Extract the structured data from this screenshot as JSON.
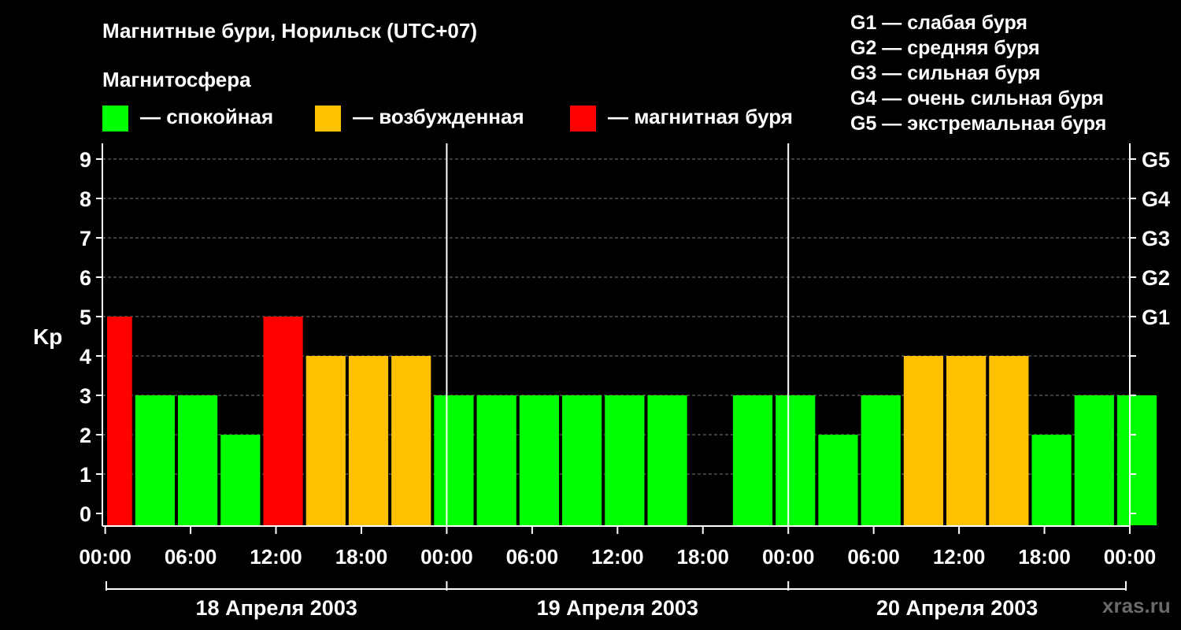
{
  "title": "Магнитные бури, Норильск (UTC+07)",
  "legend": {
    "heading": "Магнитосфера",
    "items": [
      {
        "label": "— спокойная",
        "color": "#00ff00"
      },
      {
        "label": "— возбужденная",
        "color": "#ffc000"
      },
      {
        "label": "— магнитная буря",
        "color": "#ff0000"
      }
    ]
  },
  "g_scale": [
    "G1 — слабая буря",
    "G2 — средняя буря",
    "G3 — сильная буря",
    "G4 — очень сильная буря",
    "G5 — экстремальная буря"
  ],
  "watermark": "xras.ru",
  "chart_data": {
    "type": "bar",
    "ylabel": "Kp",
    "ylim": [
      0,
      9
    ],
    "y_ticks": [
      "0",
      "1",
      "2",
      "3",
      "4",
      "5",
      "6",
      "7",
      "8",
      "9"
    ],
    "right_ticks": [
      {
        "kp": 5,
        "label": "G1"
      },
      {
        "kp": 6,
        "label": "G2"
      },
      {
        "kp": 7,
        "label": "G3"
      },
      {
        "kp": 8,
        "label": "G4"
      },
      {
        "kp": 9,
        "label": "G5"
      }
    ],
    "grid": "horizontal dashed",
    "x_tick_labels": [
      "00:00",
      "06:00",
      "12:00",
      "18:00",
      "00:00",
      "06:00",
      "12:00",
      "18:00",
      "00:00",
      "06:00",
      "12:00",
      "18:00",
      "00:00"
    ],
    "days": [
      "18 Апреля 2003",
      "19 Апреля 2003",
      "20 Апреля 2003"
    ],
    "hours_start": -0.2,
    "hours_end": 72,
    "bars": [
      {
        "start": -1,
        "kp": 5,
        "status": "storm"
      },
      {
        "start": 2,
        "kp": 3,
        "status": "quiet"
      },
      {
        "start": 5,
        "kp": 3,
        "status": "quiet"
      },
      {
        "start": 8,
        "kp": 2,
        "status": "quiet"
      },
      {
        "start": 11,
        "kp": 5,
        "status": "storm"
      },
      {
        "start": 14,
        "kp": 4,
        "status": "active"
      },
      {
        "start": 17,
        "kp": 4,
        "status": "active"
      },
      {
        "start": 20,
        "kp": 4,
        "status": "active"
      },
      {
        "start": 23,
        "kp": 3,
        "status": "quiet"
      },
      {
        "start": 26,
        "kp": 3,
        "status": "quiet"
      },
      {
        "start": 29,
        "kp": 3,
        "status": "quiet"
      },
      {
        "start": 32,
        "kp": 3,
        "status": "quiet"
      },
      {
        "start": 35,
        "kp": 3,
        "status": "quiet"
      },
      {
        "start": 38,
        "kp": 3,
        "status": "quiet"
      },
      {
        "start": 41,
        "kp": 0,
        "status": "quiet"
      },
      {
        "start": 44,
        "kp": 3,
        "status": "quiet"
      },
      {
        "start": 47,
        "kp": 3,
        "status": "quiet"
      },
      {
        "start": 50,
        "kp": 2,
        "status": "quiet"
      },
      {
        "start": 53,
        "kp": 3,
        "status": "quiet"
      },
      {
        "start": 56,
        "kp": 4,
        "status": "active"
      },
      {
        "start": 59,
        "kp": 4,
        "status": "active"
      },
      {
        "start": 62,
        "kp": 4,
        "status": "active"
      },
      {
        "start": 65,
        "kp": 2,
        "status": "quiet"
      },
      {
        "start": 68,
        "kp": 3,
        "status": "quiet"
      },
      {
        "start": 71,
        "kp": 3,
        "status": "quiet"
      }
    ],
    "status_colors": {
      "quiet": "#00ff00",
      "active": "#ffc000",
      "storm": "#ff0000"
    }
  }
}
